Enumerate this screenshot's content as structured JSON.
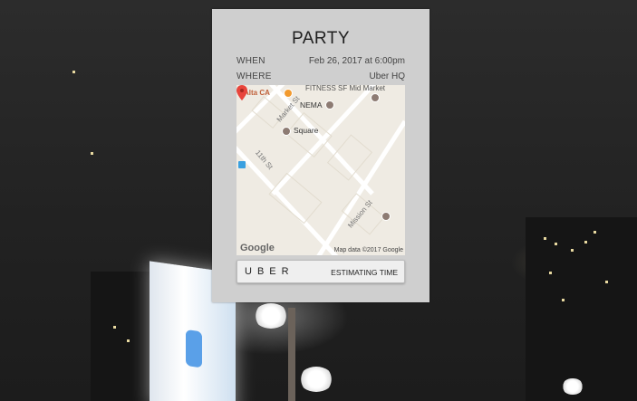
{
  "event": {
    "title": "PARTY",
    "when_label": "WHEN",
    "when_value": "Feb 26, 2017 at 6:00pm",
    "where_label": "WHERE",
    "where_value": "Uber HQ"
  },
  "map": {
    "labels": {
      "alta": "Alta CA",
      "fitness": "FITNESS SF Mid Market",
      "nema": "NEMA",
      "market": "Market St",
      "square": "Square",
      "eleventh": "11th St",
      "mission": "Mission St"
    },
    "attribution_logo": "Google",
    "attribution_text": "Map data ©2017 Google",
    "pin_color": "#e8453c"
  },
  "uber_button": {
    "logo": "UBER",
    "status": "ESTIMATING TIME"
  },
  "colors": {
    "card_bg": "#cfcfcf",
    "poi_orange": "#f29a2e"
  }
}
